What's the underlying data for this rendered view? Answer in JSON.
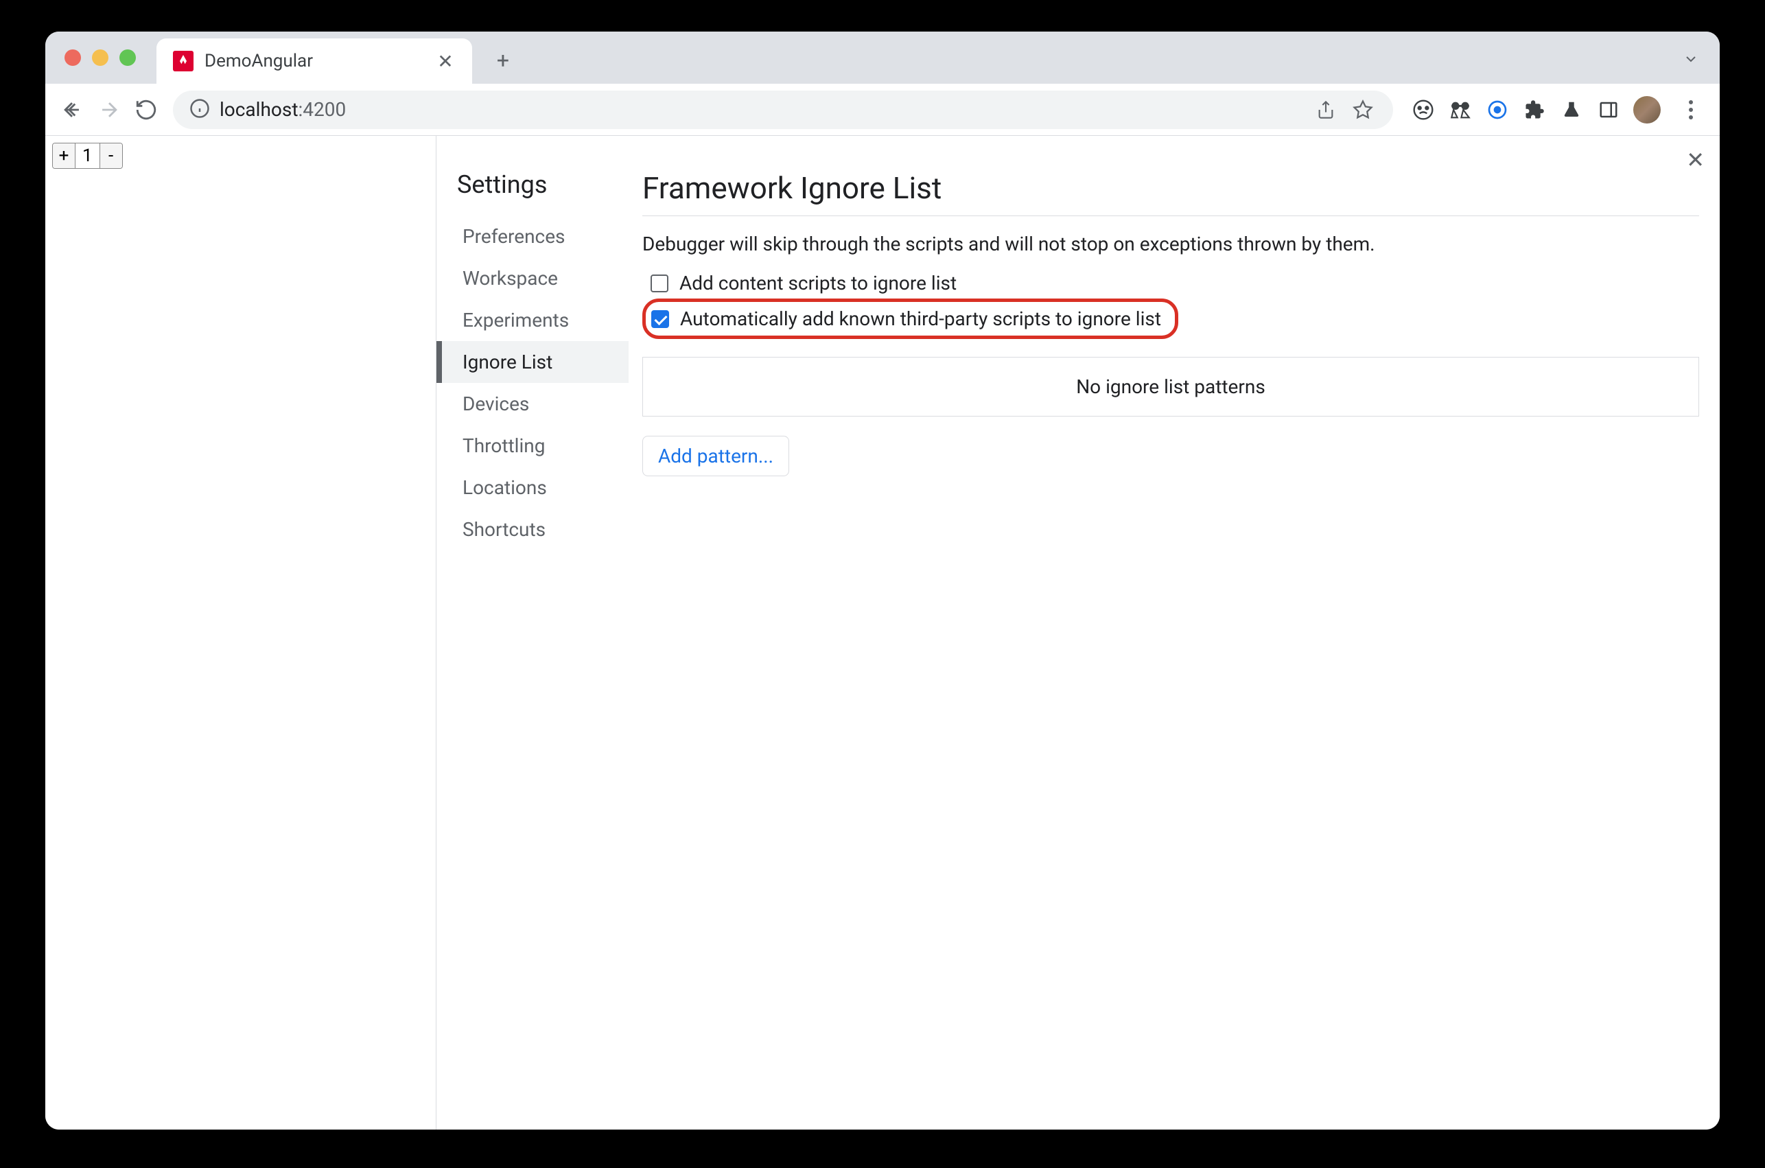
{
  "browser": {
    "tab_title": "DemoAngular",
    "url_host": "localhost",
    "url_port": ":4200"
  },
  "page": {
    "counter_value": "1",
    "plus": "+",
    "minus": "-"
  },
  "devtools": {
    "settings_title": "Settings",
    "nav_items": [
      {
        "label": "Preferences",
        "active": false
      },
      {
        "label": "Workspace",
        "active": false
      },
      {
        "label": "Experiments",
        "active": false
      },
      {
        "label": "Ignore List",
        "active": true
      },
      {
        "label": "Devices",
        "active": false
      },
      {
        "label": "Throttling",
        "active": false
      },
      {
        "label": "Locations",
        "active": false
      },
      {
        "label": "Shortcuts",
        "active": false
      }
    ],
    "content": {
      "heading": "Framework Ignore List",
      "description": "Debugger will skip through the scripts and will not stop on exceptions thrown by them.",
      "checkbox1_label": "Add content scripts to ignore list",
      "checkbox1_checked": false,
      "checkbox2_label": "Automatically add known third-party scripts to ignore list",
      "checkbox2_checked": true,
      "empty_patterns": "No ignore list patterns",
      "add_pattern_btn": "Add pattern..."
    }
  }
}
